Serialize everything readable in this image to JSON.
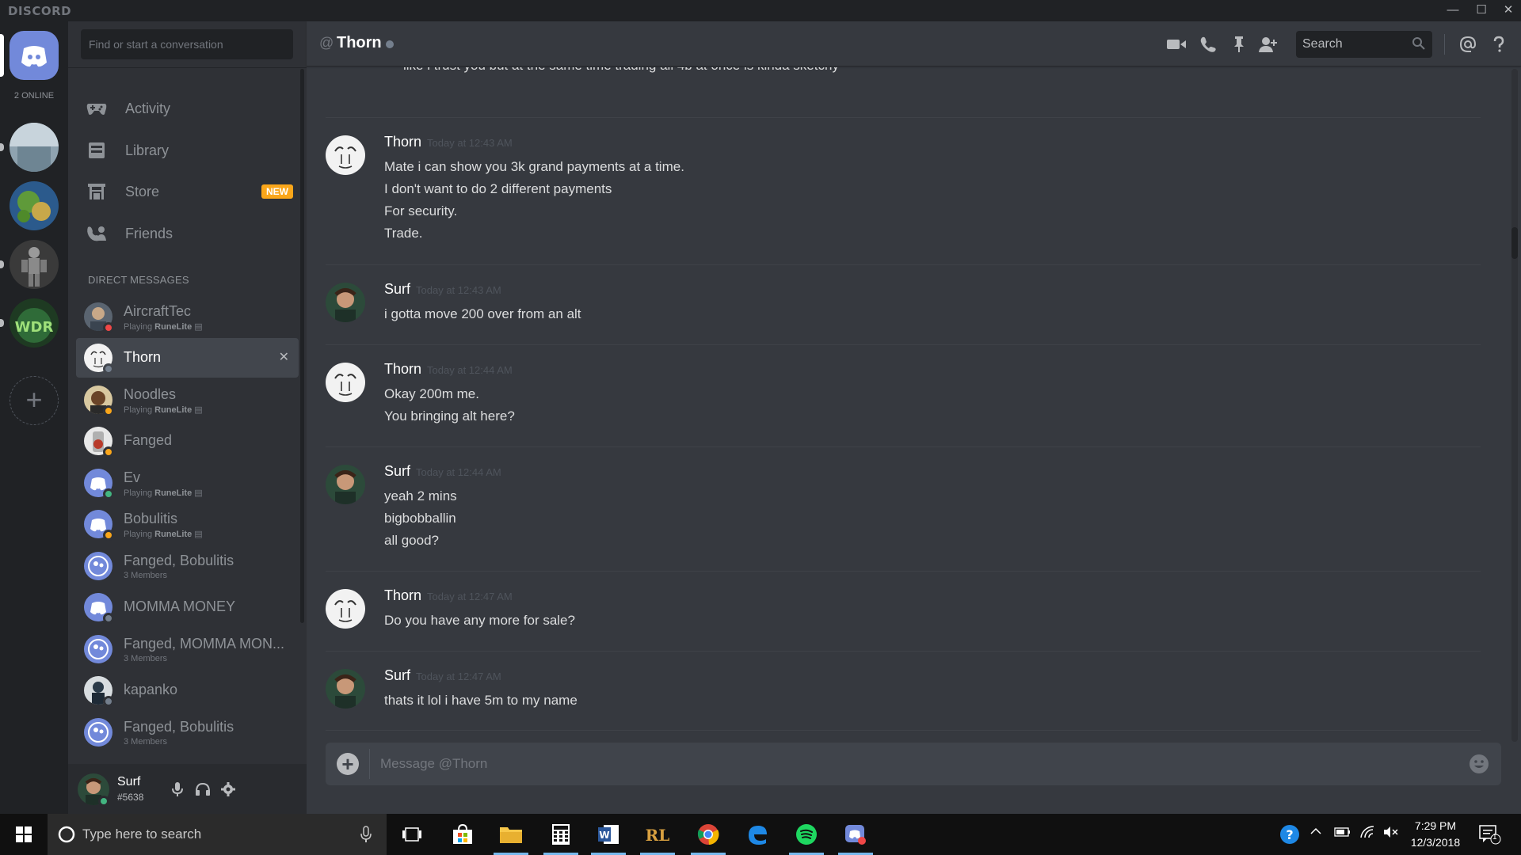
{
  "app": {
    "brand": "DISCORD",
    "online_count": "2 ONLINE"
  },
  "sidebar": {
    "search_placeholder": "Find or start a conversation",
    "nav": [
      {
        "label": "Activity",
        "icon": "gamepad-icon"
      },
      {
        "label": "Library",
        "icon": "library-icon"
      },
      {
        "label": "Store",
        "icon": "store-icon",
        "badge": "NEW"
      },
      {
        "label": "Friends",
        "icon": "friends-icon"
      }
    ],
    "dm_header": "DIRECT MESSAGES",
    "dms": [
      {
        "name": "AircraftTec",
        "sub_prefix": "Playing ",
        "sub_game": "RuneLite",
        "status": "#f04747"
      },
      {
        "name": "Thorn",
        "status": "#747f8d",
        "active": true
      },
      {
        "name": "Noodles",
        "sub_prefix": "Playing ",
        "sub_game": "RuneLite",
        "status": "#faa61a"
      },
      {
        "name": "Fanged",
        "status": "#faa61a"
      },
      {
        "name": "Ev",
        "sub_prefix": "Playing ",
        "sub_game": "RuneLite",
        "status": "#43b581"
      },
      {
        "name": "Bobulitis",
        "sub_prefix": "Playing ",
        "sub_game": "RuneLite",
        "status": "#faa61a"
      },
      {
        "name": "Fanged, Bobulitis",
        "sub_plain": "3 Members"
      },
      {
        "name": "MOMMA MONEY",
        "status": "#747f8d"
      },
      {
        "name": "Fanged, MOMMA MON...",
        "sub_plain": "3 Members"
      },
      {
        "name": "kapanko",
        "status": "#747f8d"
      },
      {
        "name": "Fanged, Bobulitis",
        "sub_plain": "3 Members"
      }
    ]
  },
  "user": {
    "name": "Surf",
    "discriminator": "#5638"
  },
  "chat": {
    "at": "@",
    "title": "Thorn",
    "search_placeholder": "Search",
    "partial_line": "like i trust you but at the same time trading all 4b at once is kinda sketchy",
    "messages": [
      {
        "author": "Thorn",
        "time": "Today at 12:43 AM",
        "lines": [
          "Mate i can show you 3k grand payments at a time.",
          "I don't want to do 2 different payments",
          "For security.",
          "Trade."
        ]
      },
      {
        "author": "Surf",
        "time": "Today at 12:43 AM",
        "lines": [
          "i gotta move 200 over from an alt"
        ]
      },
      {
        "author": "Thorn",
        "time": "Today at 12:44 AM",
        "lines": [
          "Okay 200m me.",
          "You bringing alt here?"
        ]
      },
      {
        "author": "Surf",
        "time": "Today at 12:44 AM",
        "lines": [
          "yeah 2 mins",
          "bigbobballin",
          "all good?"
        ]
      },
      {
        "author": "Thorn",
        "time": "Today at 12:47 AM",
        "lines": [
          "Do you have any more for sale?"
        ]
      },
      {
        "author": "Surf",
        "time": "Today at 12:47 AM",
        "lines": [
          "thats it lol i have 5m to my name"
        ]
      }
    ],
    "composer_placeholder": "Message @Thorn"
  },
  "taskbar": {
    "search_placeholder": "Type here to search",
    "time": "7:29 PM",
    "date": "12/3/2018",
    "notification_count": "1"
  },
  "colors": {
    "blurple": "#7289da",
    "online": "#43b581",
    "idle": "#faa61a",
    "dnd": "#f04747",
    "offline": "#747f8d"
  }
}
